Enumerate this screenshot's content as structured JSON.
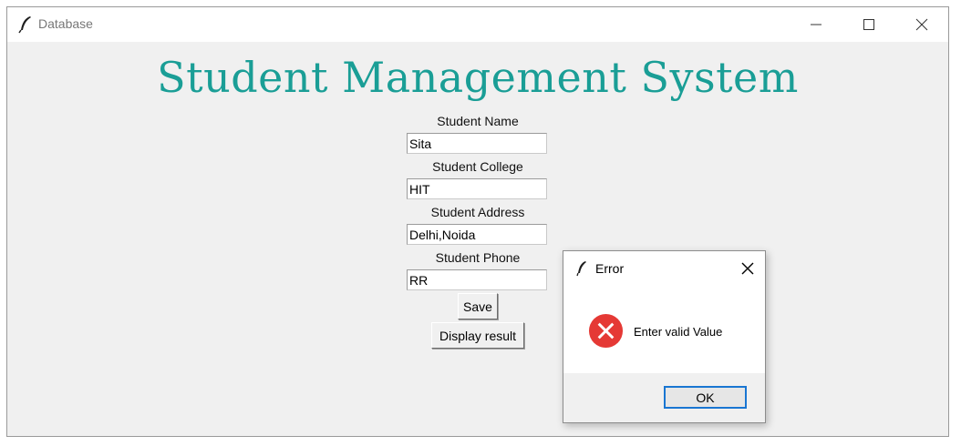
{
  "window": {
    "title": "Database",
    "icon": "feather-icon",
    "controls": [
      "minimize-icon",
      "maximize-icon",
      "close-icon"
    ]
  },
  "app": {
    "title": "Student Management System",
    "title_color": "#1a9e96"
  },
  "form": {
    "fields": [
      {
        "label": "Student Name",
        "value": "Sita"
      },
      {
        "label": "Student College",
        "value": "HIT"
      },
      {
        "label": "Student Address",
        "value": "Delhi,Noida"
      },
      {
        "label": "Student Phone",
        "value": "RR"
      }
    ],
    "save_label": "Save",
    "display_label": "Display result"
  },
  "dialog": {
    "title": "Error",
    "message": "Enter valid Value",
    "ok_label": "OK",
    "icon": "error-icon",
    "icon_color": "#e53935",
    "ok_border_color": "#1976d2"
  }
}
